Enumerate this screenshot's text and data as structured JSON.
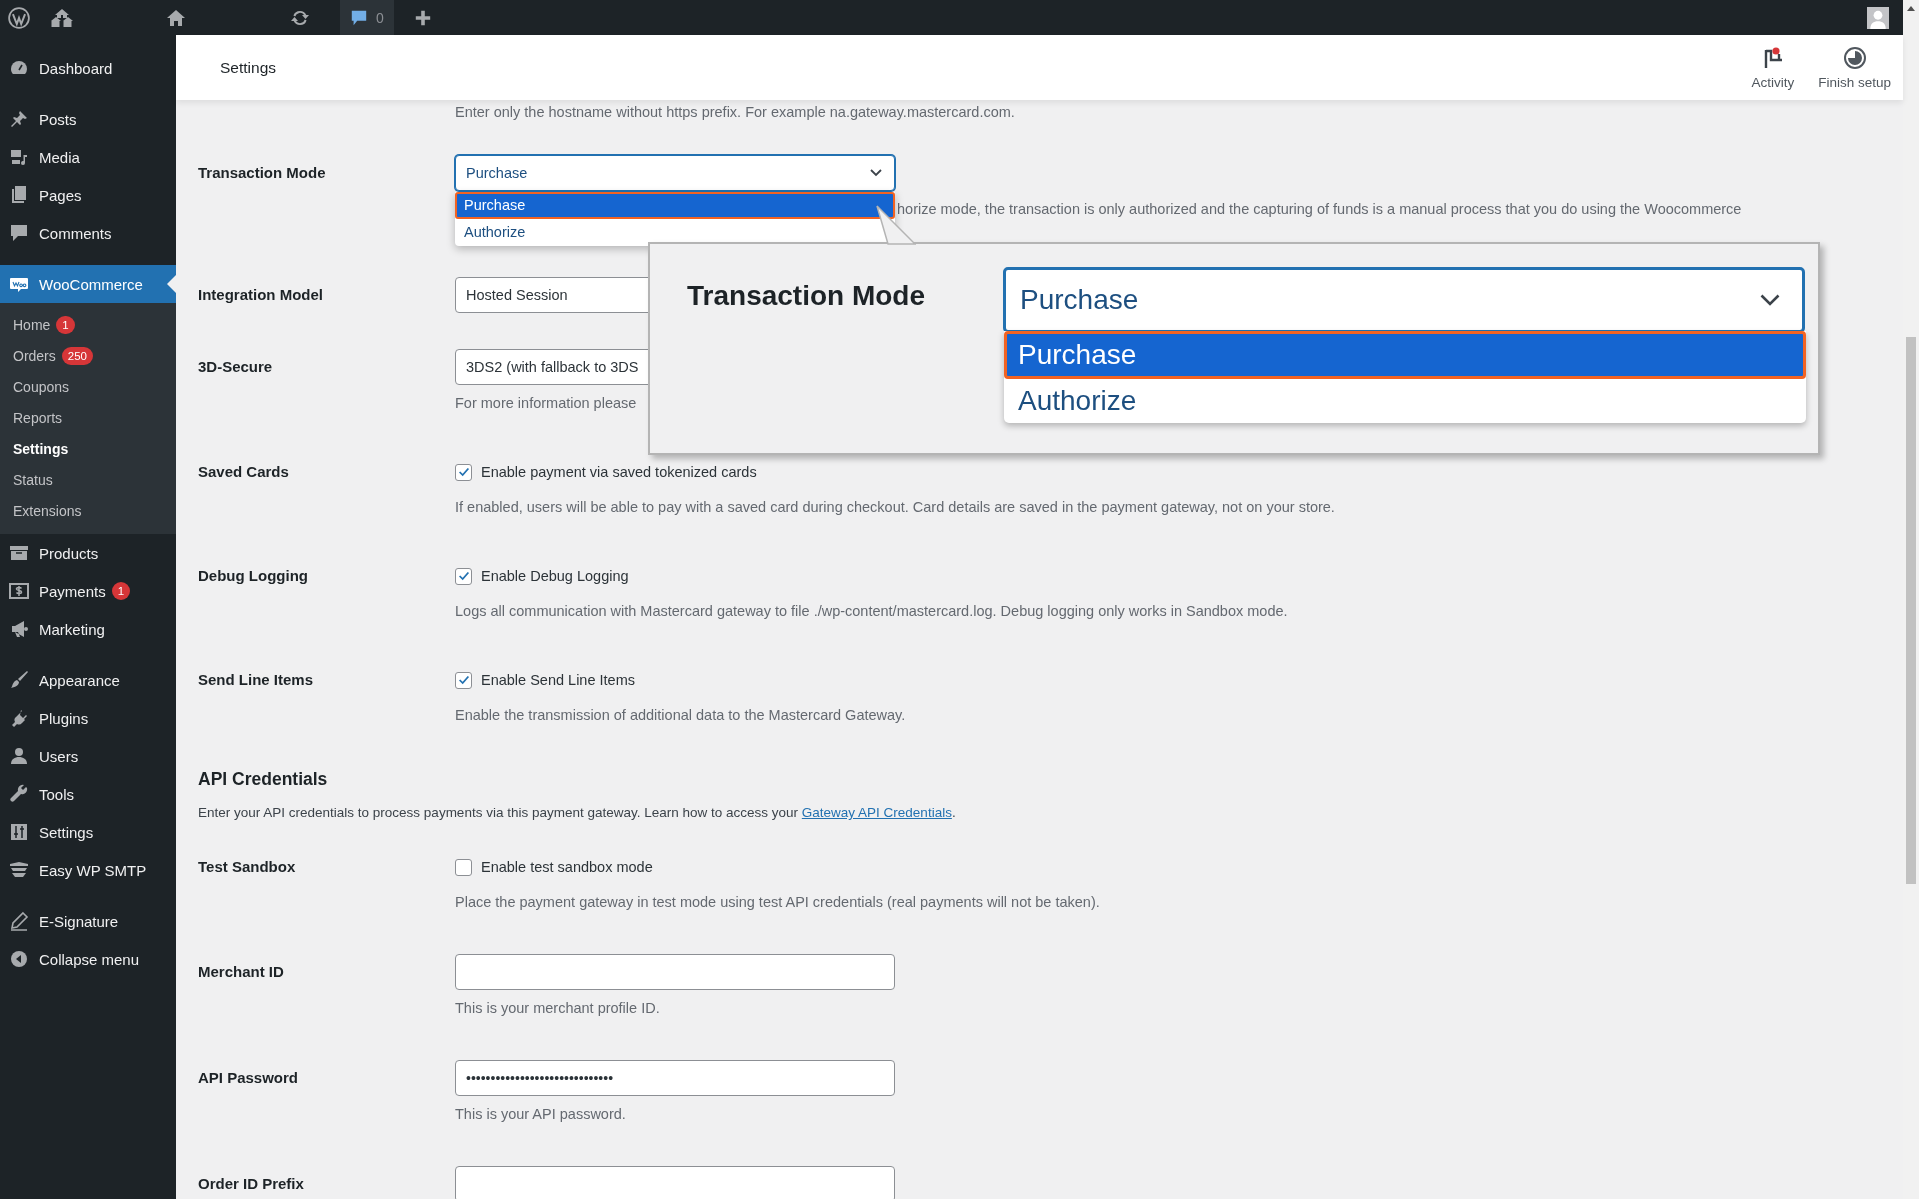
{
  "top_bar": {
    "comment_count": "0"
  },
  "sidebar": {
    "sections": [
      [
        {
          "label": "Dashboard",
          "selected": false
        }
      ],
      [
        {
          "label": "Posts",
          "selected": false
        },
        {
          "label": "Media",
          "selected": false
        },
        {
          "label": "Pages",
          "selected": false
        },
        {
          "label": "Comments",
          "selected": false
        }
      ],
      [
        {
          "label": "WooCommerce",
          "selected": true,
          "children": [
            {
              "label": "Home",
              "badge": "1",
              "selected": false
            },
            {
              "label": "Orders",
              "badge": "250",
              "selected": false
            },
            {
              "label": "Coupons",
              "selected": false
            },
            {
              "label": "Reports",
              "selected": false
            },
            {
              "label": "Settings",
              "selected": true
            },
            {
              "label": "Status",
              "selected": false
            },
            {
              "label": "Extensions",
              "selected": false
            }
          ]
        },
        {
          "label": "Products",
          "selected": false
        },
        {
          "label": "Payments",
          "badge": "1",
          "selected": false
        },
        {
          "label": "Marketing",
          "selected": false
        }
      ],
      [
        {
          "label": "Appearance",
          "selected": false
        },
        {
          "label": "Plugins",
          "selected": false
        },
        {
          "label": "Users",
          "selected": false
        },
        {
          "label": "Tools",
          "selected": false
        },
        {
          "label": "Settings",
          "selected": false
        },
        {
          "label": "Easy WP SMTP",
          "selected": false
        }
      ],
      [
        {
          "label": "E-Signature",
          "selected": false
        },
        {
          "label": "Collapse menu",
          "selected": false
        }
      ]
    ]
  },
  "header": {
    "title": "Settings",
    "actions": [
      {
        "label": "Activity",
        "notification": true
      },
      {
        "label": "Finish setup",
        "notification": false
      }
    ]
  },
  "settings": {
    "hint": "Enter only the hostname without https prefix. For example na.gateway.mastercard.com.",
    "rows": [
      {
        "kind": "select",
        "label": "Transaction Mode",
        "value": "Purchase",
        "expanded": true,
        "options": [
          {
            "label": "Purchase",
            "selected": true
          },
          {
            "label": "Authorize",
            "selected": false
          }
        ],
        "description": "horize mode, the transaction is only authorized and the capturing of funds is a manual process that you do using the Woocommerce"
      },
      {
        "kind": "select",
        "label": "Integration Model",
        "value": "Hosted Session",
        "expanded": false
      },
      {
        "kind": "select",
        "label": "3D-Secure",
        "value": "3DS2 (with fallback to 3DS",
        "expanded": false,
        "description": "For more information please"
      },
      {
        "kind": "checkbox",
        "label": "Saved Cards",
        "checkbox_label": "Enable payment via saved tokenized cards",
        "checked": true,
        "description": "If enabled, users will be able to pay with a saved card during checkout. Card details are saved in the payment gateway, not on your store."
      },
      {
        "kind": "checkbox",
        "label": "Debug Logging",
        "checkbox_label": "Enable Debug Logging",
        "checked": true,
        "description": "Logs all communication with Mastercard gateway to file ./wp-content/mastercard.log. Debug logging only works in Sandbox mode."
      },
      {
        "kind": "checkbox",
        "label": "Send Line Items",
        "checkbox_label": "Enable Send Line Items",
        "checked": true,
        "description": "Enable the transmission of additional data to the Mastercard Gateway."
      },
      {
        "kind": "heading",
        "title": "API Credentials"
      },
      {
        "kind": "paragraph",
        "text": "Enter your API credentials to process payments via this payment gateway. Learn how to access your ",
        "link": "Gateway API Credentials",
        "text_after": "."
      },
      {
        "kind": "checkbox",
        "label": "Test Sandbox",
        "checkbox_label": "Enable test sandbox mode",
        "checked": false,
        "description": "Place the payment gateway in test mode using test API credentials (real payments will not be taken)."
      },
      {
        "kind": "text",
        "label": "Merchant ID",
        "description": "This is your merchant profile ID."
      },
      {
        "kind": "text",
        "label": "API Password",
        "value": "••••••••••••••••••••••••••••••",
        "description": "This is your API password."
      },
      {
        "kind": "text",
        "label": "Order ID Prefix"
      }
    ]
  },
  "callout": {
    "label": "Transaction Mode",
    "value": "Purchase",
    "expanded": true,
    "options": [
      {
        "label": "Purchase",
        "selected": true
      },
      {
        "label": "Authorize",
        "selected": false
      }
    ]
  }
}
